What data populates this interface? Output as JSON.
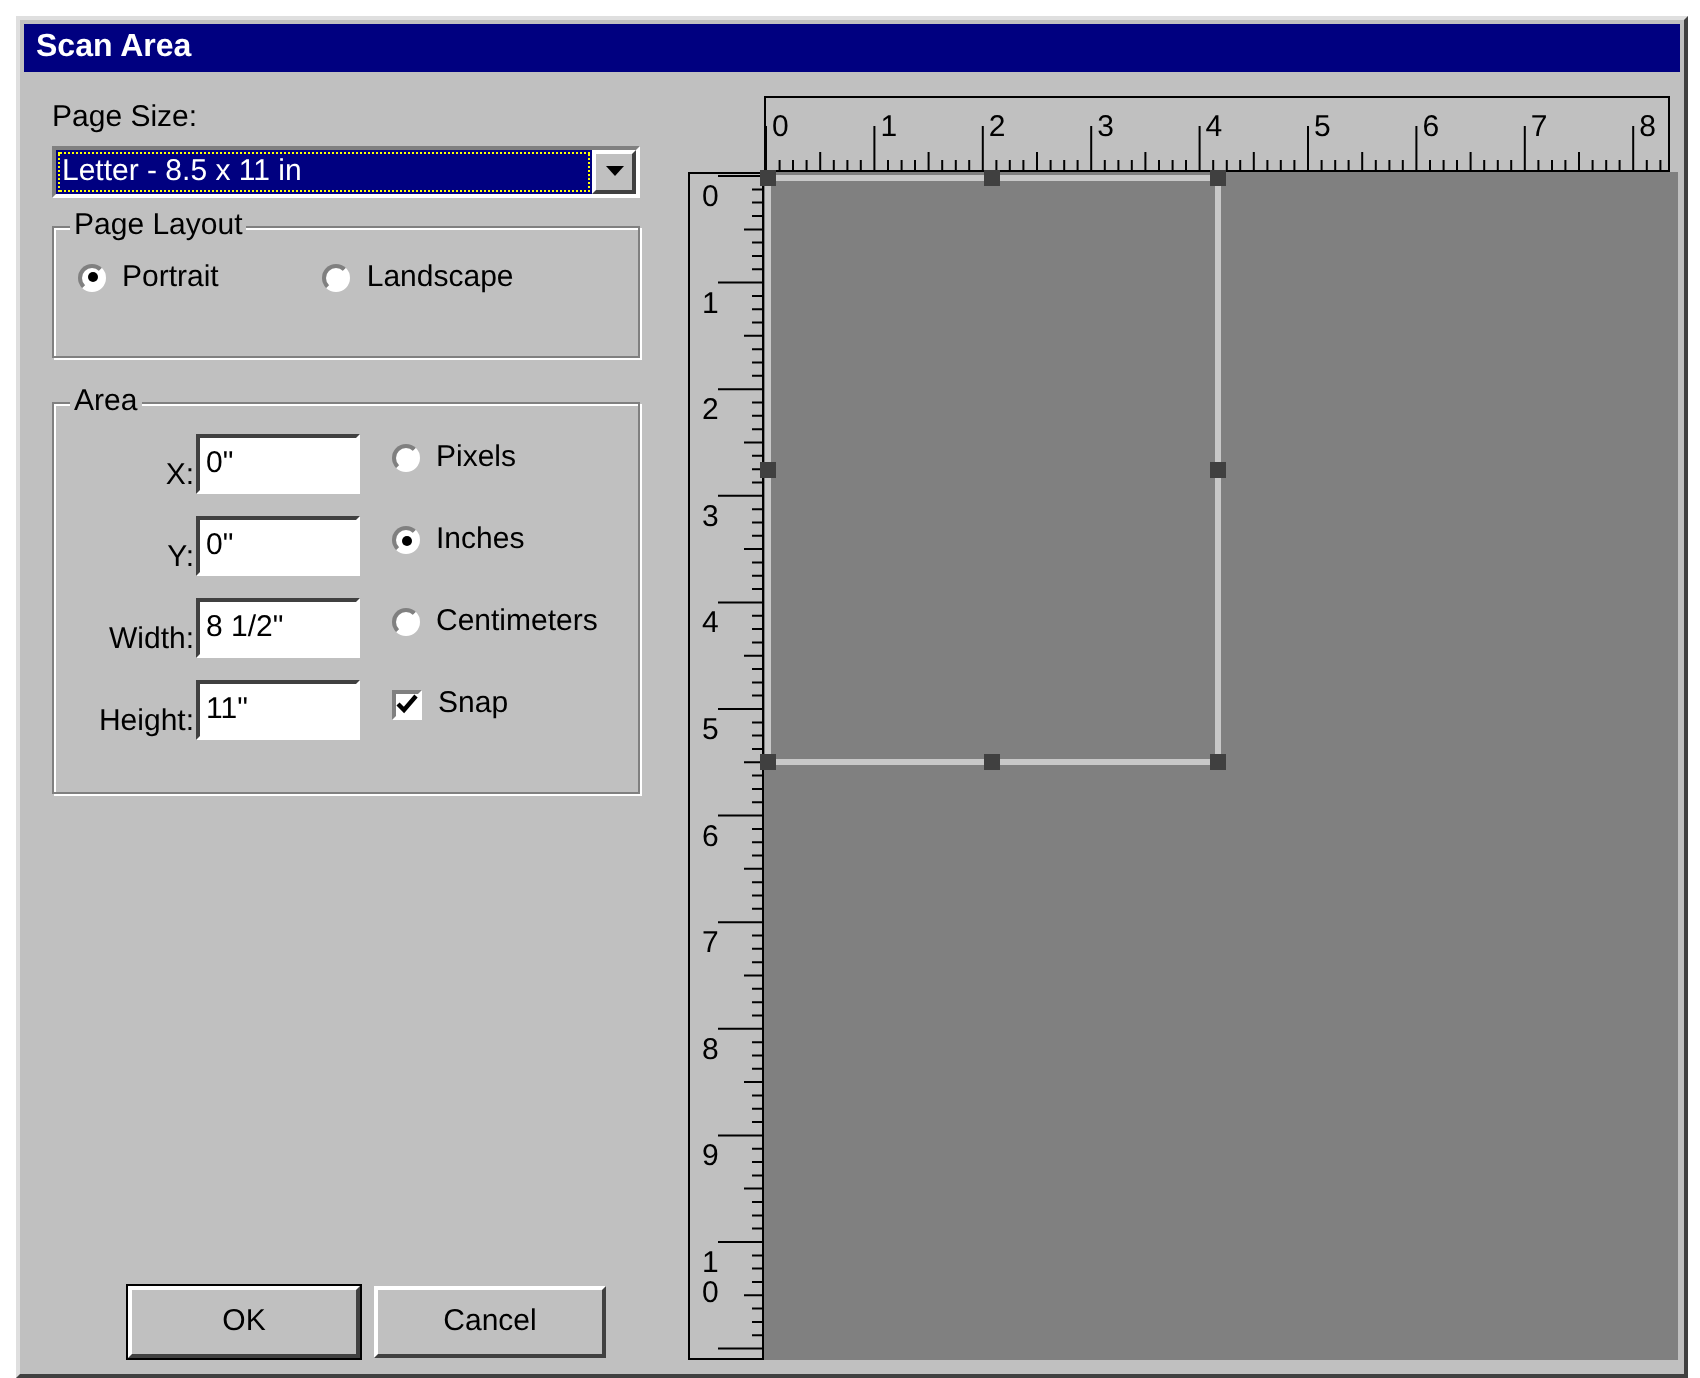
{
  "window": {
    "title": "Scan Area"
  },
  "page_size": {
    "label": "Page Size:",
    "value": "Letter - 8.5 x 11 in"
  },
  "page_layout": {
    "title": "Page Layout",
    "options": [
      {
        "label": "Portrait",
        "selected": true
      },
      {
        "label": "Landscape",
        "selected": false
      }
    ]
  },
  "area": {
    "title": "Area",
    "fields": [
      {
        "label": "X:",
        "value": "0\""
      },
      {
        "label": "Y:",
        "value": "0\""
      },
      {
        "label": "Width:",
        "value": "8 1/2\""
      },
      {
        "label": "Height:",
        "value": "11\""
      }
    ],
    "units": [
      {
        "label": "Pixels",
        "selected": false
      },
      {
        "label": "Inches",
        "selected": true
      },
      {
        "label": "Centimeters",
        "selected": false
      }
    ],
    "snap": {
      "label": "Snap",
      "checked": true
    }
  },
  "buttons": [
    {
      "label": "OK",
      "default": true
    },
    {
      "label": "Cancel",
      "default": false
    }
  ],
  "rulers": {
    "horizontal": [
      "0",
      "1",
      "2",
      "3",
      "4",
      "5",
      "6",
      "7",
      "8"
    ],
    "vertical": [
      "0",
      "1",
      "2",
      "3",
      "4",
      "5",
      "6",
      "7",
      "8",
      "9",
      "10"
    ]
  }
}
